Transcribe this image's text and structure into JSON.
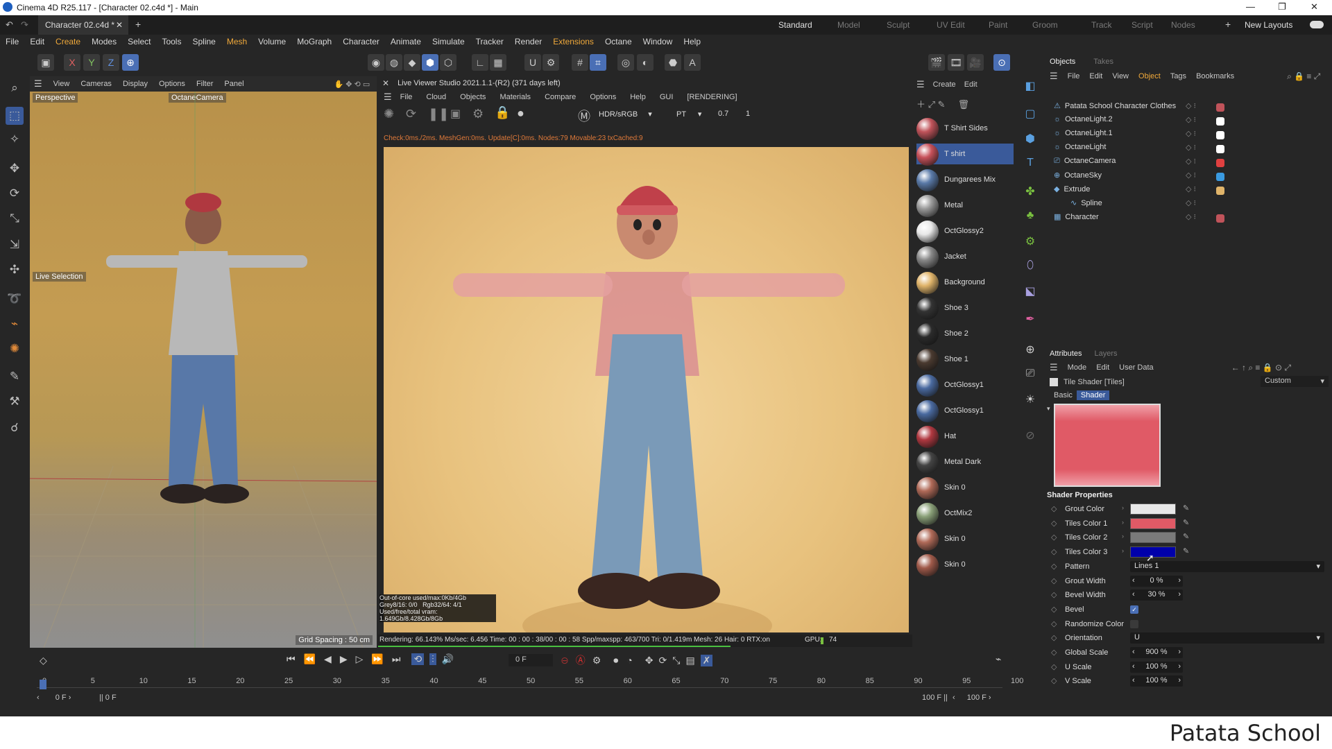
{
  "window": {
    "title": "Cinema 4D R25.117 - [Character 02.c4d *] - Main"
  },
  "tabs": {
    "doc": "Character 02.c4d *",
    "add": "+"
  },
  "layouts": {
    "items": [
      "Standard",
      "Model",
      "Sculpt",
      "UV Edit",
      "Paint",
      "Groom",
      "Track",
      "Script",
      "Nodes"
    ],
    "new": "New Layouts"
  },
  "menu": [
    "File",
    "Edit",
    "Create",
    "Modes",
    "Select",
    "Tools",
    "Spline",
    "Mesh",
    "Volume",
    "MoGraph",
    "Character",
    "Animate",
    "Simulate",
    "Tracker",
    "Render",
    "Extensions",
    "Octane",
    "Window",
    "Help"
  ],
  "axis_buttons": [
    "X",
    "Y",
    "Z"
  ],
  "viewport": {
    "menu": [
      "View",
      "Cameras",
      "Display",
      "Options",
      "Filter",
      "Panel"
    ],
    "label": "Perspective",
    "camera": "OctaneCamera",
    "live": "Live Selection",
    "grid": "Grid Spacing : 50 cm"
  },
  "octane": {
    "title": "Live Viewer Studio 2021.1.1-(R2) (371 days left)",
    "menu": [
      "File",
      "Cloud",
      "Objects",
      "Materials",
      "Compare",
      "Options",
      "Help",
      "GUI",
      "[RENDERING]"
    ],
    "colorspace": "HDR/sRGB",
    "kernel": "PT",
    "exposure": "0.7",
    "layer": "1",
    "check": "Check:0ms./2ms. MeshGen:0ms. Update[C]:0ms. Nodes:79 Movable:23 txCached:9",
    "stats": [
      "Out-of-core used/max:0Kb/4Gb",
      "Grey8/16: 0/0",
      "Rgb32/64: 4/1",
      "Used/free/total vram: 1.649Gb/8.428Gb/8Gb"
    ],
    "status": "Rendering: 66.143%  Ms/sec: 6.456  Time: 00 : 00 : 38/00 : 00 : 58  Spp/maxspp: 463/700  Tri: 0/1.419m  Mesh: 26  Hair: 0  RTX:on",
    "gpu": "GPU:",
    "gpu_val": "74",
    "progress": 0.66
  },
  "materials": {
    "menu": [
      "Create",
      "Edit"
    ],
    "items": [
      {
        "name": "T Shirt Sides",
        "color": "#c0535a"
      },
      {
        "name": "T shirt",
        "color": "#c7515a"
      },
      {
        "name": "Dungarees Mix",
        "color": "#5a7aa8"
      },
      {
        "name": "Metal",
        "color": "#9a9a9a"
      },
      {
        "name": "OctGlossy2",
        "color": "#e8e8e8"
      },
      {
        "name": "Jacket",
        "color": "#888"
      },
      {
        "name": "Background",
        "color": "#e0b46a"
      },
      {
        "name": "Shoe 3",
        "color": "#333"
      },
      {
        "name": "Shoe 2",
        "color": "#2b2b2b"
      },
      {
        "name": "Shoe 1",
        "color": "#4a3a30"
      },
      {
        "name": "OctGlossy1",
        "color": "#4a6aa0"
      },
      {
        "name": "OctGlossy1",
        "color": "#4a6aa0"
      },
      {
        "name": "Hat",
        "color": "#b03840"
      },
      {
        "name": "Metal Dark",
        "color": "#444"
      },
      {
        "name": "Skin 0",
        "color": "#b06a58"
      },
      {
        "name": "OctMix2",
        "color": "#8aa078"
      },
      {
        "name": "Skin 0",
        "color": "#b06a58"
      },
      {
        "name": "Skin 0",
        "color": "#a05a4a"
      }
    ]
  },
  "objects": {
    "tabs": [
      "Objects",
      "Takes"
    ],
    "menu": [
      "File",
      "Edit",
      "View",
      "Object",
      "Tags",
      "Bookmarks"
    ],
    "items": [
      {
        "name": "Patata School Character Clothes",
        "indent": 0
      },
      {
        "name": "OctaneLight.2",
        "indent": 0
      },
      {
        "name": "OctaneLight.1",
        "indent": 0
      },
      {
        "name": "OctaneLight",
        "indent": 0
      },
      {
        "name": "OctaneCamera",
        "indent": 0
      },
      {
        "name": "OctaneSky",
        "indent": 0
      },
      {
        "name": "Extrude",
        "indent": 0
      },
      {
        "name": "Spline",
        "indent": 1
      },
      {
        "name": "Character",
        "indent": 0
      }
    ]
  },
  "attributes": {
    "tabs": [
      "Attributes",
      "Layers"
    ],
    "menu": [
      "Mode",
      "Edit",
      "User Data"
    ],
    "object": "Tile Shader [Tiles]",
    "preset": "Custom",
    "subtabs": [
      "Basic",
      "Shader"
    ],
    "section": "Shader Properties",
    "props": [
      {
        "label": "Grout Color",
        "type": "color",
        "color": "#e8e8e8"
      },
      {
        "label": "Tiles Color 1",
        "type": "color",
        "color": "#e05a66"
      },
      {
        "label": "Tiles Color 2",
        "type": "color",
        "color": "#7a7a7a"
      },
      {
        "label": "Tiles Color 3",
        "type": "color",
        "color": "#0000aa"
      },
      {
        "label": "Pattern",
        "type": "select",
        "value": "Lines 1"
      },
      {
        "label": "Grout Width",
        "type": "num",
        "value": "0 %"
      },
      {
        "label": "Bevel Width",
        "type": "num",
        "value": "30 %"
      },
      {
        "label": "Bevel",
        "type": "check",
        "checked": true
      },
      {
        "label": "Randomize Color",
        "type": "check",
        "checked": false
      },
      {
        "label": "Orientation",
        "type": "select",
        "value": "U"
      },
      {
        "label": "Global Scale",
        "type": "num",
        "value": "900 %"
      },
      {
        "label": "U Scale",
        "type": "num",
        "value": "100 %"
      },
      {
        "label": "V Scale",
        "type": "num",
        "value": "100 %"
      }
    ]
  },
  "timeline": {
    "frame": "0 F",
    "ticks": [
      "0",
      "5",
      "10",
      "15",
      "20",
      "25",
      "30",
      "35",
      "40",
      "45",
      "50",
      "55",
      "60",
      "65",
      "70",
      "75",
      "80",
      "85",
      "90",
      "95",
      "100"
    ],
    "start": "0 F",
    "start2": "0 F",
    "end": "100 F",
    "end2": "100 F"
  },
  "brand": "Patata School"
}
